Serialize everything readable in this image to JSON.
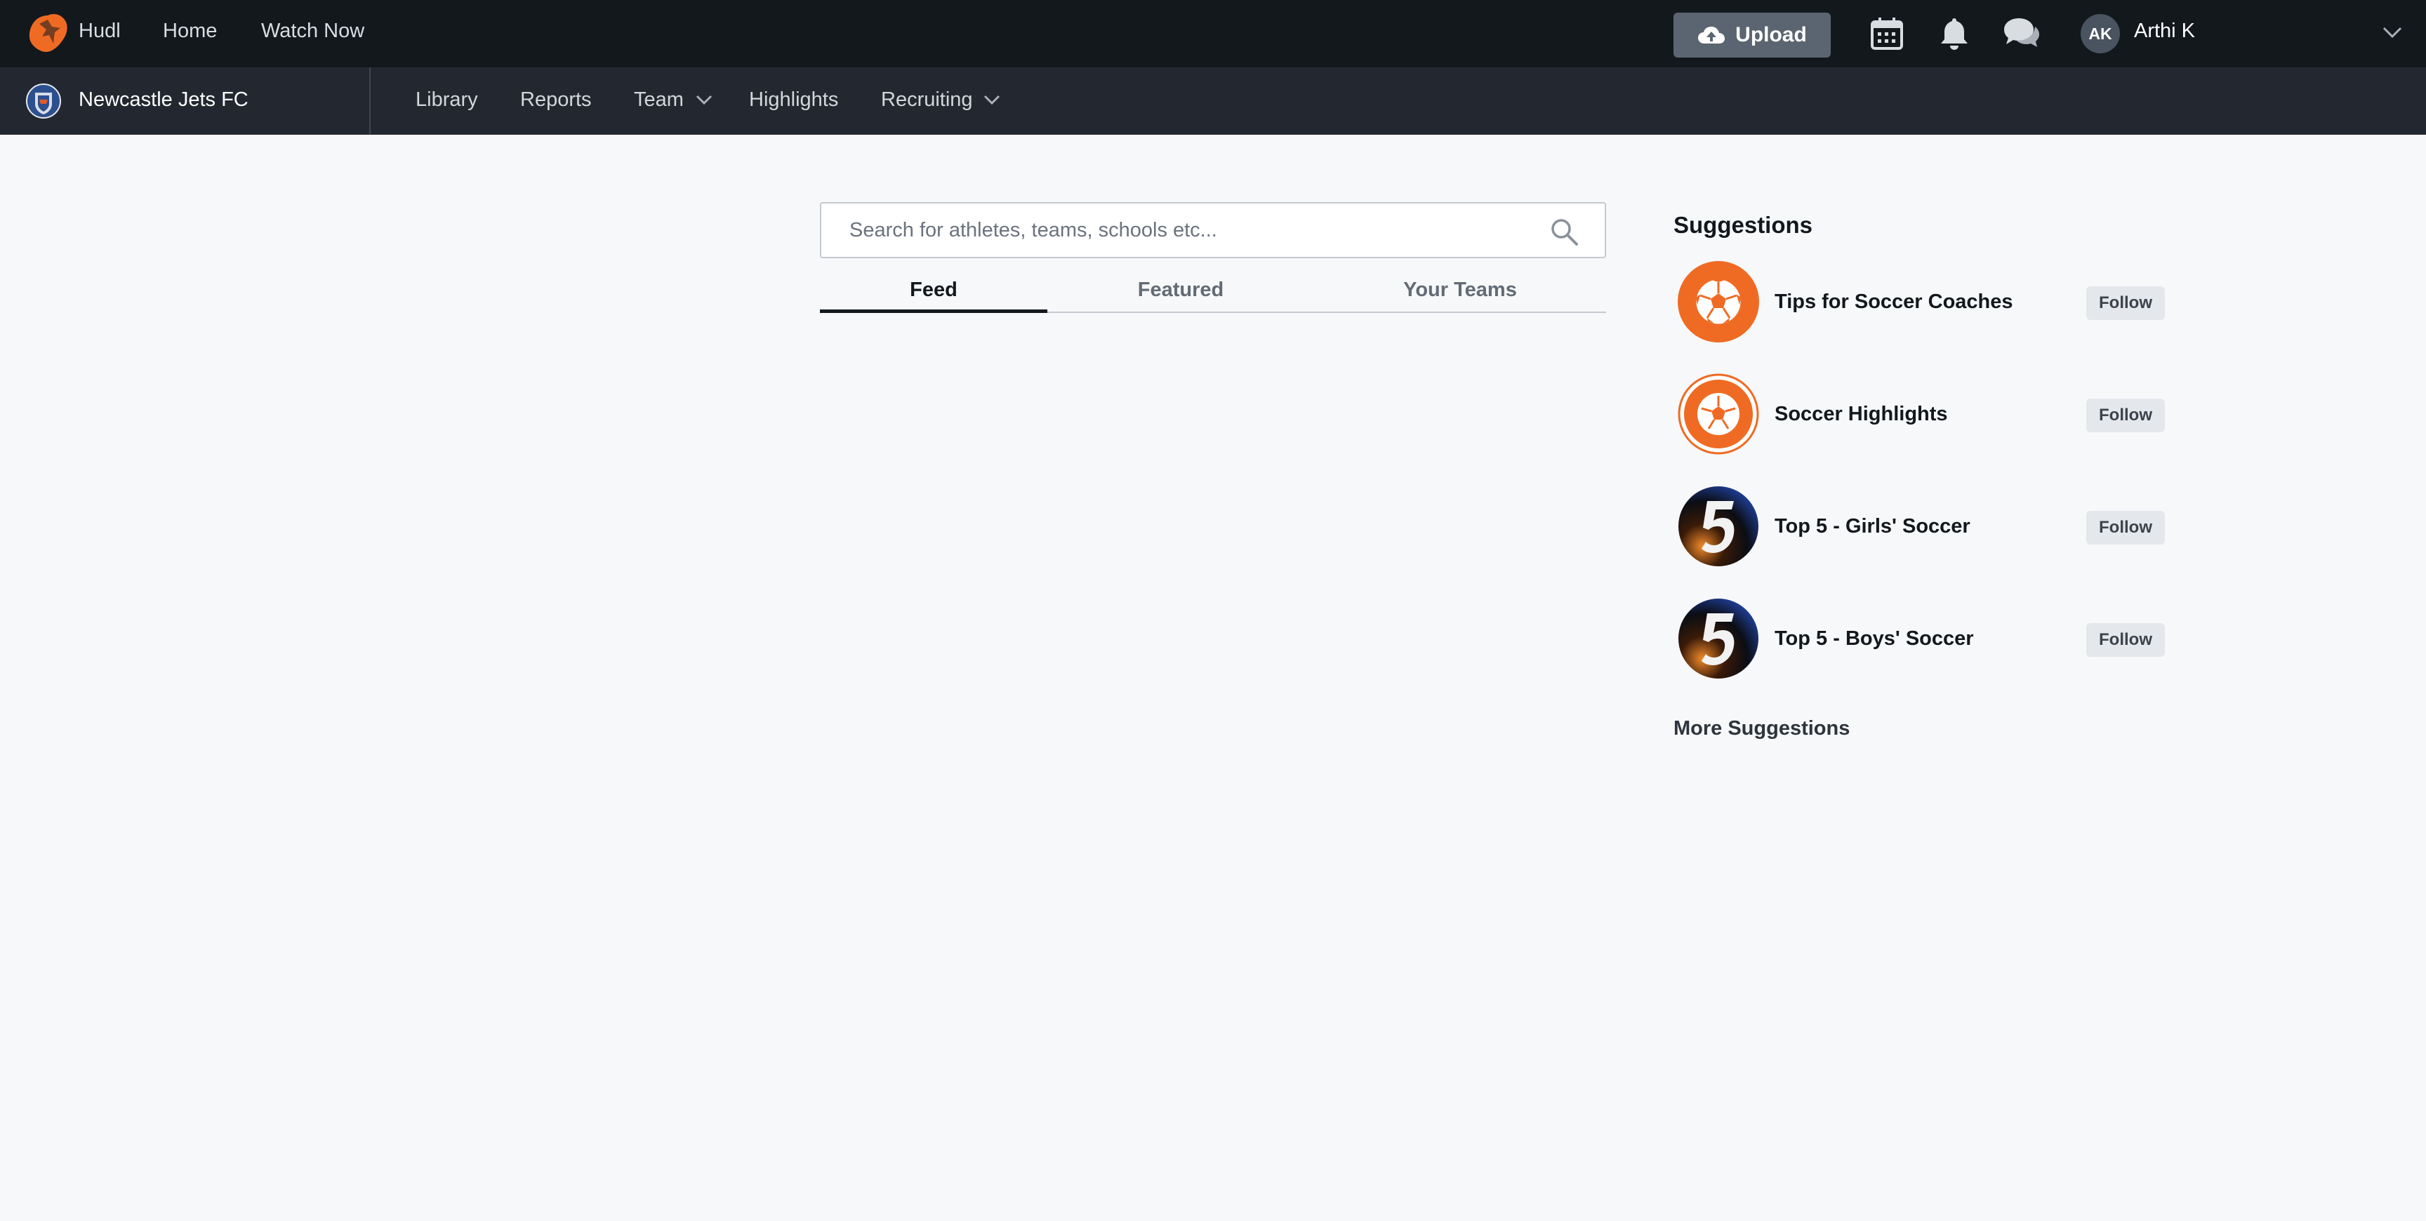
{
  "topbar": {
    "brand": "Hudl",
    "links": [
      "Home",
      "Watch Now"
    ],
    "upload_label": "Upload",
    "user_initials": "AK",
    "user_name": "Arthi K"
  },
  "subbar": {
    "team_name": "Newcastle Jets FC",
    "nav": [
      "Library",
      "Reports",
      "Team",
      "Highlights",
      "Recruiting"
    ]
  },
  "search": {
    "placeholder": "Search for athletes, teams, schools etc..."
  },
  "tabs": [
    "Feed",
    "Featured",
    "Your Teams"
  ],
  "suggestions": {
    "title": "Suggestions",
    "items": [
      {
        "name": "Tips for Soccer Coaches",
        "follow": "Follow",
        "icon": "soccer-ball-icon"
      },
      {
        "name": "Soccer Highlights",
        "follow": "Follow",
        "icon": "soccer-ball-outline-icon"
      },
      {
        "name": "Top 5 - Girls' Soccer",
        "follow": "Follow",
        "icon": "top-five-icon"
      },
      {
        "name": "Top 5 - Boys' Soccer",
        "follow": "Follow",
        "icon": "top-five-icon"
      }
    ],
    "more": "More Suggestions"
  },
  "colors": {
    "accent": "#ef6b24",
    "topbar": "#13181d",
    "subbar": "#232830",
    "background": "#f7f8fa"
  }
}
